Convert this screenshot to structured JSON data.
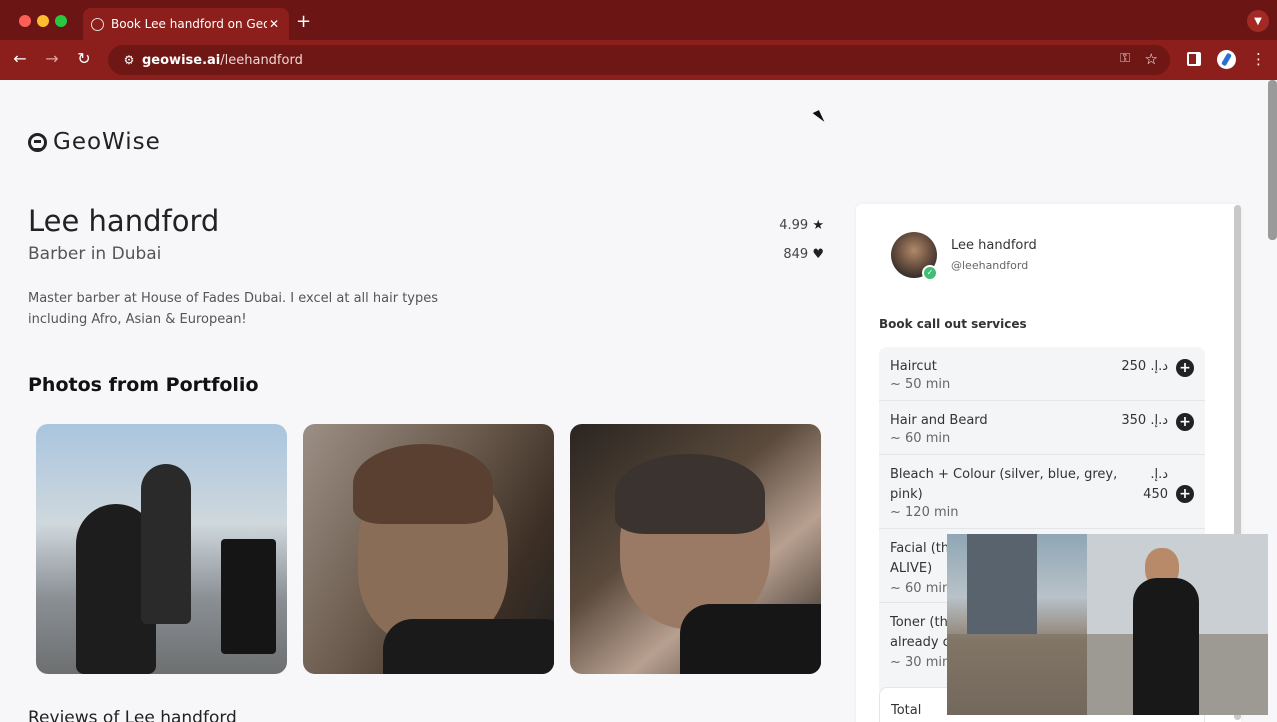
{
  "browser": {
    "tab_title": "Book Lee handford on GeoWise",
    "new_tab_icon": "plus-icon",
    "url_host": "geowise.ai",
    "url_path": "/leehandford"
  },
  "site": {
    "brand": "GeoWise"
  },
  "profile": {
    "name": "Lee handford",
    "role": "Barber in Dubai",
    "rating": "4.99",
    "likes": "849",
    "bio": "Master barber at House of Fades Dubai. I excel at all hair types including Afro, Asian & European!"
  },
  "portfolio": {
    "title": "Photos from Portfolio"
  },
  "reviews": {
    "title": "Reviews of Lee handford"
  },
  "booking": {
    "name": "Lee handford",
    "handle": "@leehandford",
    "heading": "Book call out services",
    "services": [
      {
        "name": "Haircut",
        "duration": "~ 50 min",
        "price": "250 .د.إ"
      },
      {
        "name": "Hair and Beard",
        "duration": "~ 60 min",
        "price": "350 .د.إ"
      },
      {
        "name": "Bleach + Colour (silver, blue, grey, pink)",
        "duration": "~ 120 min",
        "price": ".د.إ 450"
      },
      {
        "name": "Facial (th",
        "name_line2": "ALIVE)",
        "duration": "~ 60 min",
        "price": ""
      },
      {
        "name": "Toner (th",
        "name_line2": "already c",
        "duration": "~ 30 min",
        "price": ""
      }
    ],
    "total_label": "Total"
  },
  "colors": {
    "chrome_tabbar": "#6b1614",
    "chrome_toolbar": "#8c1f1b",
    "page_bg": "#f7f7f9",
    "verified": "#3fbf72"
  }
}
